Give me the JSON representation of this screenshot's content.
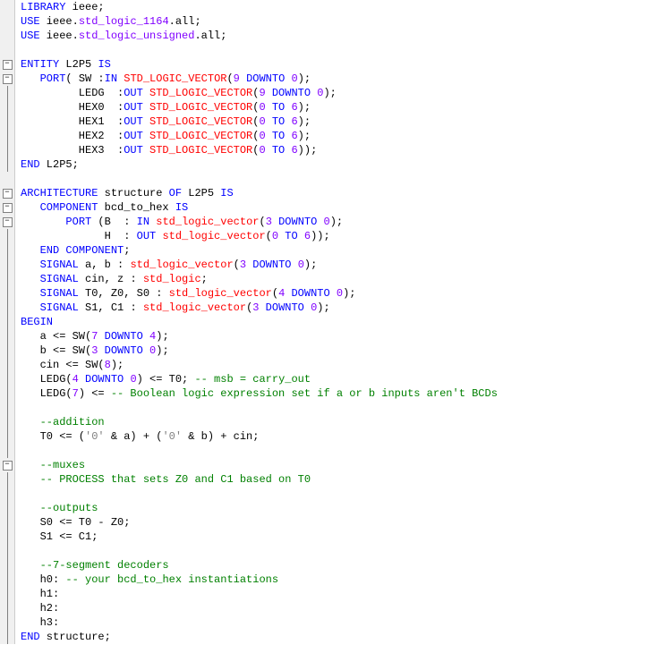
{
  "lines": [
    {
      "fold": "none",
      "tokens": [
        [
          "kw",
          "LIBRARY"
        ],
        [
          "plain",
          " ieee;"
        ]
      ]
    },
    {
      "fold": "none",
      "tokens": [
        [
          "kw",
          "USE"
        ],
        [
          "plain",
          " ieee."
        ],
        [
          "str-ish",
          "std_logic_1164"
        ],
        [
          "plain",
          ".all;"
        ]
      ]
    },
    {
      "fold": "none",
      "tokens": [
        [
          "kw",
          "USE"
        ],
        [
          "plain",
          " ieee."
        ],
        [
          "str-ish",
          "std_logic_unsigned"
        ],
        [
          "plain",
          ".all;"
        ]
      ]
    },
    {
      "fold": "none",
      "tokens": []
    },
    {
      "fold": "minus",
      "tokens": [
        [
          "kw",
          "ENTITY"
        ],
        [
          "plain",
          " L2P5 "
        ],
        [
          "kw",
          "IS"
        ]
      ]
    },
    {
      "fold": "minus",
      "tokens": [
        [
          "plain",
          "   "
        ],
        [
          "kw",
          "PORT"
        ],
        [
          "plain",
          "( SW :"
        ],
        [
          "kw",
          "IN"
        ],
        [
          "plain",
          " "
        ],
        [
          "type",
          "STD_LOGIC_VECTOR"
        ],
        [
          "plain",
          "("
        ],
        [
          "str-ish",
          "9"
        ],
        [
          "plain",
          " "
        ],
        [
          "kw",
          "DOWNTO"
        ],
        [
          "plain",
          " "
        ],
        [
          "str-ish",
          "0"
        ],
        [
          "plain",
          ");"
        ]
      ]
    },
    {
      "fold": "vline",
      "tokens": [
        [
          "plain",
          "         LEDG  :"
        ],
        [
          "kw",
          "OUT"
        ],
        [
          "plain",
          " "
        ],
        [
          "type",
          "STD_LOGIC_VECTOR"
        ],
        [
          "plain",
          "("
        ],
        [
          "str-ish",
          "9"
        ],
        [
          "plain",
          " "
        ],
        [
          "kw",
          "DOWNTO"
        ],
        [
          "plain",
          " "
        ],
        [
          "str-ish",
          "0"
        ],
        [
          "plain",
          ");"
        ]
      ]
    },
    {
      "fold": "vline",
      "tokens": [
        [
          "plain",
          "         HEX0  :"
        ],
        [
          "kw",
          "OUT"
        ],
        [
          "plain",
          " "
        ],
        [
          "type",
          "STD_LOGIC_VECTOR"
        ],
        [
          "plain",
          "("
        ],
        [
          "str-ish",
          "0"
        ],
        [
          "plain",
          " "
        ],
        [
          "kw",
          "TO"
        ],
        [
          "plain",
          " "
        ],
        [
          "str-ish",
          "6"
        ],
        [
          "plain",
          ");"
        ]
      ]
    },
    {
      "fold": "vline",
      "tokens": [
        [
          "plain",
          "         HEX1  :"
        ],
        [
          "kw",
          "OUT"
        ],
        [
          "plain",
          " "
        ],
        [
          "type",
          "STD_LOGIC_VECTOR"
        ],
        [
          "plain",
          "("
        ],
        [
          "str-ish",
          "0"
        ],
        [
          "plain",
          " "
        ],
        [
          "kw",
          "TO"
        ],
        [
          "plain",
          " "
        ],
        [
          "str-ish",
          "6"
        ],
        [
          "plain",
          ");"
        ]
      ]
    },
    {
      "fold": "vline",
      "tokens": [
        [
          "plain",
          "         HEX2  :"
        ],
        [
          "kw",
          "OUT"
        ],
        [
          "plain",
          " "
        ],
        [
          "type",
          "STD_LOGIC_VECTOR"
        ],
        [
          "plain",
          "("
        ],
        [
          "str-ish",
          "0"
        ],
        [
          "plain",
          " "
        ],
        [
          "kw",
          "TO"
        ],
        [
          "plain",
          " "
        ],
        [
          "str-ish",
          "6"
        ],
        [
          "plain",
          ");"
        ]
      ]
    },
    {
      "fold": "vline",
      "tokens": [
        [
          "plain",
          "         HEX3  :"
        ],
        [
          "kw",
          "OUT"
        ],
        [
          "plain",
          " "
        ],
        [
          "type",
          "STD_LOGIC_VECTOR"
        ],
        [
          "plain",
          "("
        ],
        [
          "str-ish",
          "0"
        ],
        [
          "plain",
          " "
        ],
        [
          "kw",
          "TO"
        ],
        [
          "plain",
          " "
        ],
        [
          "str-ish",
          "6"
        ],
        [
          "plain",
          "));"
        ]
      ]
    },
    {
      "fold": "vline",
      "tokens": [
        [
          "kw",
          "END"
        ],
        [
          "plain",
          " L2P5;"
        ]
      ]
    },
    {
      "fold": "none",
      "tokens": []
    },
    {
      "fold": "minus",
      "tokens": [
        [
          "kw",
          "ARCHITECTURE"
        ],
        [
          "plain",
          " structure "
        ],
        [
          "kw",
          "OF"
        ],
        [
          "plain",
          " L2P5 "
        ],
        [
          "kw",
          "IS"
        ]
      ]
    },
    {
      "fold": "minus",
      "tokens": [
        [
          "plain",
          "   "
        ],
        [
          "kw",
          "COMPONENT"
        ],
        [
          "plain",
          " bcd_to_hex "
        ],
        [
          "kw",
          "IS"
        ]
      ]
    },
    {
      "fold": "minus",
      "tokens": [
        [
          "plain",
          "       "
        ],
        [
          "kw",
          "PORT"
        ],
        [
          "plain",
          " (B  : "
        ],
        [
          "kw",
          "IN"
        ],
        [
          "plain",
          " "
        ],
        [
          "type",
          "std_logic_vector"
        ],
        [
          "plain",
          "("
        ],
        [
          "str-ish",
          "3"
        ],
        [
          "plain",
          " "
        ],
        [
          "kw",
          "DOWNTO"
        ],
        [
          "plain",
          " "
        ],
        [
          "str-ish",
          "0"
        ],
        [
          "plain",
          ");"
        ]
      ]
    },
    {
      "fold": "vline",
      "tokens": [
        [
          "plain",
          "             H  : "
        ],
        [
          "kw",
          "OUT"
        ],
        [
          "plain",
          " "
        ],
        [
          "type",
          "std_logic_vector"
        ],
        [
          "plain",
          "("
        ],
        [
          "str-ish",
          "0"
        ],
        [
          "plain",
          " "
        ],
        [
          "kw",
          "TO"
        ],
        [
          "plain",
          " "
        ],
        [
          "str-ish",
          "6"
        ],
        [
          "plain",
          "));"
        ]
      ]
    },
    {
      "fold": "vline",
      "tokens": [
        [
          "plain",
          "   "
        ],
        [
          "kw",
          "END COMPONENT"
        ],
        [
          "plain",
          ";"
        ]
      ]
    },
    {
      "fold": "vline",
      "tokens": [
        [
          "plain",
          "   "
        ],
        [
          "kw",
          "SIGNAL"
        ],
        [
          "plain",
          " a, b : "
        ],
        [
          "type",
          "std_logic_vector"
        ],
        [
          "plain",
          "("
        ],
        [
          "str-ish",
          "3"
        ],
        [
          "plain",
          " "
        ],
        [
          "kw",
          "DOWNTO"
        ],
        [
          "plain",
          " "
        ],
        [
          "str-ish",
          "0"
        ],
        [
          "plain",
          ");"
        ]
      ]
    },
    {
      "fold": "vline",
      "tokens": [
        [
          "plain",
          "   "
        ],
        [
          "kw",
          "SIGNAL"
        ],
        [
          "plain",
          " cin, z : "
        ],
        [
          "type",
          "std_logic"
        ],
        [
          "plain",
          ";"
        ]
      ]
    },
    {
      "fold": "vline",
      "tokens": [
        [
          "plain",
          "   "
        ],
        [
          "kw",
          "SIGNAL"
        ],
        [
          "plain",
          " T0, Z0, S0 : "
        ],
        [
          "type",
          "std_logic_vector"
        ],
        [
          "plain",
          "("
        ],
        [
          "str-ish",
          "4"
        ],
        [
          "plain",
          " "
        ],
        [
          "kw",
          "DOWNTO"
        ],
        [
          "plain",
          " "
        ],
        [
          "str-ish",
          "0"
        ],
        [
          "plain",
          ");"
        ]
      ]
    },
    {
      "fold": "vline",
      "tokens": [
        [
          "plain",
          "   "
        ],
        [
          "kw",
          "SIGNAL"
        ],
        [
          "plain",
          " S1, C1 : "
        ],
        [
          "type",
          "std_logic_vector"
        ],
        [
          "plain",
          "("
        ],
        [
          "str-ish",
          "3"
        ],
        [
          "plain",
          " "
        ],
        [
          "kw",
          "DOWNTO"
        ],
        [
          "plain",
          " "
        ],
        [
          "str-ish",
          "0"
        ],
        [
          "plain",
          ");"
        ]
      ]
    },
    {
      "fold": "vline",
      "tokens": [
        [
          "kw",
          "BEGIN"
        ]
      ]
    },
    {
      "fold": "vline",
      "tokens": [
        [
          "plain",
          "   a <= SW("
        ],
        [
          "str-ish",
          "7"
        ],
        [
          "plain",
          " "
        ],
        [
          "kw",
          "DOWNTO"
        ],
        [
          "plain",
          " "
        ],
        [
          "str-ish",
          "4"
        ],
        [
          "plain",
          ");"
        ]
      ]
    },
    {
      "fold": "vline",
      "tokens": [
        [
          "plain",
          "   b <= SW("
        ],
        [
          "str-ish",
          "3"
        ],
        [
          "plain",
          " "
        ],
        [
          "kw",
          "DOWNTO"
        ],
        [
          "plain",
          " "
        ],
        [
          "str-ish",
          "0"
        ],
        [
          "plain",
          ");"
        ]
      ]
    },
    {
      "fold": "vline",
      "tokens": [
        [
          "plain",
          "   cin <= SW("
        ],
        [
          "str-ish",
          "8"
        ],
        [
          "plain",
          ");"
        ]
      ]
    },
    {
      "fold": "vline",
      "tokens": [
        [
          "plain",
          "   LEDG("
        ],
        [
          "str-ish",
          "4"
        ],
        [
          "plain",
          " "
        ],
        [
          "kw",
          "DOWNTO"
        ],
        [
          "plain",
          " "
        ],
        [
          "str-ish",
          "0"
        ],
        [
          "plain",
          ") <= T0; "
        ],
        [
          "comment",
          "-- msb = carry_out"
        ]
      ]
    },
    {
      "fold": "vline",
      "tokens": [
        [
          "plain",
          "   LEDG("
        ],
        [
          "str-ish",
          "7"
        ],
        [
          "plain",
          ") <= "
        ],
        [
          "comment",
          "-- Boolean logic expression set if a or b inputs aren't BCDs"
        ]
      ]
    },
    {
      "fold": "vline",
      "tokens": []
    },
    {
      "fold": "vline",
      "tokens": [
        [
          "plain",
          "   "
        ],
        [
          "comment",
          "--addition"
        ]
      ]
    },
    {
      "fold": "vline",
      "tokens": [
        [
          "plain",
          "   T0 <= ("
        ],
        [
          "literal",
          "'0'"
        ],
        [
          "plain",
          " & a) + ("
        ],
        [
          "literal",
          "'0'"
        ],
        [
          "plain",
          " & b) + cin;"
        ]
      ]
    },
    {
      "fold": "vline",
      "tokens": []
    },
    {
      "fold": "minus",
      "tokens": [
        [
          "plain",
          "   "
        ],
        [
          "comment",
          "--muxes"
        ]
      ]
    },
    {
      "fold": "vline",
      "tokens": [
        [
          "plain",
          "   "
        ],
        [
          "comment",
          "-- PROCESS that sets Z0 and C1 based on T0"
        ]
      ]
    },
    {
      "fold": "vline",
      "tokens": []
    },
    {
      "fold": "vline",
      "tokens": [
        [
          "plain",
          "   "
        ],
        [
          "comment",
          "--outputs"
        ]
      ]
    },
    {
      "fold": "vline",
      "tokens": [
        [
          "plain",
          "   S0 <= T0 - Z0;"
        ]
      ]
    },
    {
      "fold": "vline",
      "tokens": [
        [
          "plain",
          "   S1 <= C1;"
        ]
      ]
    },
    {
      "fold": "vline",
      "tokens": []
    },
    {
      "fold": "vline",
      "tokens": [
        [
          "plain",
          "   "
        ],
        [
          "comment",
          "--7-segment decoders"
        ]
      ]
    },
    {
      "fold": "vline",
      "tokens": [
        [
          "plain",
          "   h0: "
        ],
        [
          "comment",
          "-- your bcd_to_hex instantiations"
        ]
      ]
    },
    {
      "fold": "vline",
      "tokens": [
        [
          "plain",
          "   h1:"
        ]
      ]
    },
    {
      "fold": "vline",
      "tokens": [
        [
          "plain",
          "   h2:"
        ]
      ]
    },
    {
      "fold": "vline",
      "tokens": [
        [
          "plain",
          "   h3:"
        ]
      ]
    },
    {
      "fold": "vline",
      "tokens": [
        [
          "kw",
          "END"
        ],
        [
          "plain",
          " structure;"
        ]
      ]
    }
  ]
}
